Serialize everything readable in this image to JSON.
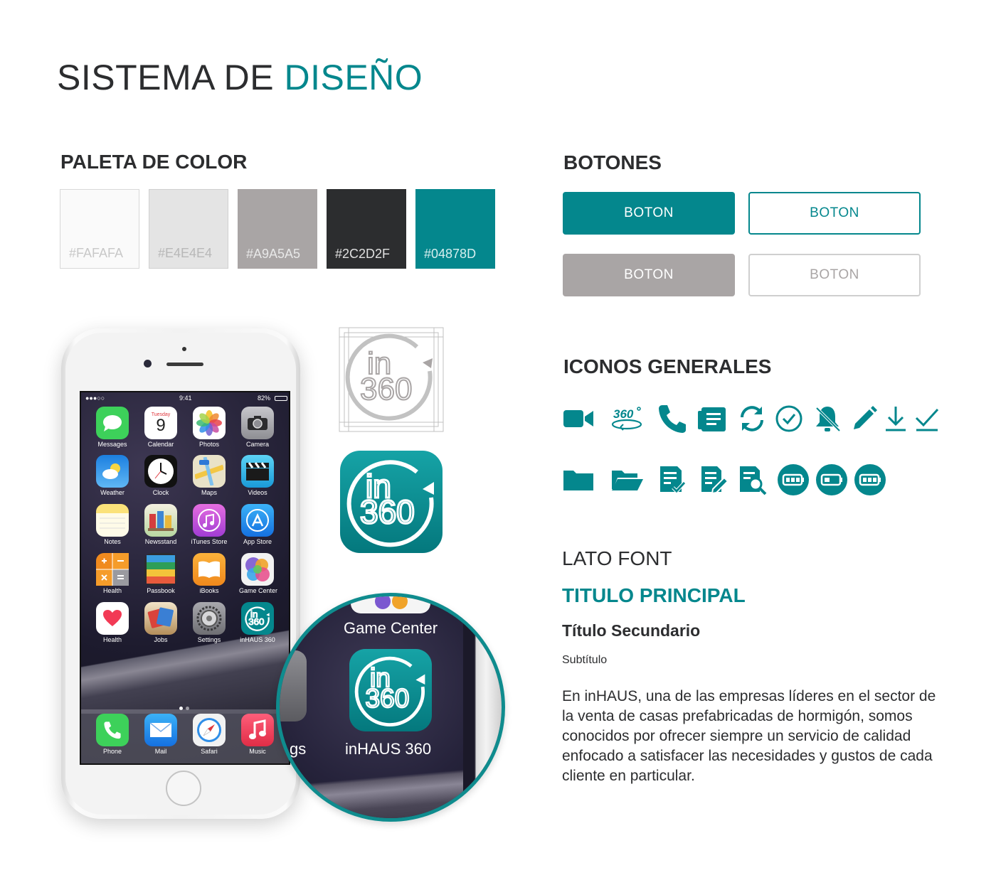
{
  "header": {
    "title_main": "SISTEMA DE",
    "title_accent": "DISEÑO"
  },
  "palette": {
    "heading": "PALETA DE COLOR",
    "swatches": [
      {
        "hex": "#FAFAFA",
        "label": "#FAFAFA"
      },
      {
        "hex": "#E4E4E4",
        "label": "#E4E4E4"
      },
      {
        "hex": "#A9A5A5",
        "label": "#A9A5A5"
      },
      {
        "hex": "#2C2D2F",
        "label": "#2C2D2F"
      },
      {
        "hex": "#04878D",
        "label": "#04878D"
      }
    ]
  },
  "buttons": {
    "heading": "BOTONES",
    "items": [
      {
        "label": "BOTON",
        "style": "primary-filled"
      },
      {
        "label": "BOTON",
        "style": "primary-outline"
      },
      {
        "label": "BOTON",
        "style": "gray-filled"
      },
      {
        "label": "BOTON",
        "style": "gray-outline"
      }
    ]
  },
  "icons": {
    "heading": "ICONOS GENERALES",
    "color": "#04878D",
    "row1": [
      "video-camera-icon",
      "360-view-icon",
      "phone-icon",
      "document-list-icon",
      "sync-icon",
      "check-circle-icon",
      "bell-off-icon",
      "pencil-icon",
      "download-icon",
      "checkmark-icon"
    ],
    "row2": [
      "folder-icon",
      "folder-open-icon",
      "document-check-icon",
      "document-edit-icon",
      "document-search-icon",
      "battery-low-icon",
      "battery-half-icon",
      "battery-full-icon"
    ],
    "row1_text": {
      "360": "360"
    }
  },
  "logo": {
    "text_top": "in",
    "text_bottom": "360",
    "color": "#04878D"
  },
  "typography": {
    "heading": "LATO FONT",
    "title": "TITULO PRINCIPAL",
    "secondary": "Título Secundario",
    "subtitle": "Subtítulo",
    "body": "En inHAUS, una de las empresas líderes en el sector de la venta de casas prefabricadas de hormigón, somos conocidos por ofrecer siempre un servicio de calidad enfocado a satisfacer las necesidades y gustos de cada cliente en particular."
  },
  "phone": {
    "status": {
      "carrier": "●●●○○",
      "time": "9:41",
      "battery": "82%"
    },
    "calendar": {
      "day_name": "Tuesday",
      "day_number": "9"
    },
    "apps": [
      {
        "label": "Messages",
        "icon": "messages-icon",
        "color": "#3dd15a"
      },
      {
        "label": "Calendar",
        "icon": "calendar-icon",
        "color": "#ffffff"
      },
      {
        "label": "Photos",
        "icon": "photos-icon",
        "color": "#ffffff"
      },
      {
        "label": "Camera",
        "icon": "camera-icon",
        "color": "#9a9aa0"
      },
      {
        "label": "Weather",
        "icon": "weather-icon",
        "color": "#2d8ee8"
      },
      {
        "label": "Clock",
        "icon": "clock-icon",
        "color": "#111111"
      },
      {
        "label": "Maps",
        "icon": "maps-icon",
        "color": "#e9e2c8"
      },
      {
        "label": "Videos",
        "icon": "videos-icon",
        "color": "#2fb4e6"
      },
      {
        "label": "Notes",
        "icon": "notes-icon",
        "color": "#fbe27a"
      },
      {
        "label": "Newsstand",
        "icon": "newsstand-icon",
        "color": "#b8d7a2"
      },
      {
        "label": "iTunes Store",
        "icon": "itunes-icon",
        "color": "#d74cd0"
      },
      {
        "label": "App Store",
        "icon": "app-store-icon",
        "color": "#1c8ef0"
      },
      {
        "label": "Health",
        "icon": "calculator-icon",
        "color": "#f08a1e"
      },
      {
        "label": "Passbook",
        "icon": "passbook-icon",
        "color": "#2e9e57"
      },
      {
        "label": "iBooks",
        "icon": "ibooks-icon",
        "color": "#f59a1b"
      },
      {
        "label": "Game Center",
        "icon": "game-center-icon",
        "color": "#f2f2f2"
      },
      {
        "label": "Health",
        "icon": "health-icon",
        "color": "#ffffff"
      },
      {
        "label": "Jobs",
        "icon": "jobs-icon",
        "color": "#c54a2b"
      },
      {
        "label": "Settings",
        "icon": "settings-icon",
        "color": "#8e8e93"
      },
      {
        "label": "inHAUS 360",
        "icon": "inhaus-360-icon",
        "color": "#04878d"
      }
    ],
    "dock": [
      {
        "label": "Phone",
        "icon": "phone-app-icon",
        "color": "#3dd15a"
      },
      {
        "label": "Mail",
        "icon": "mail-icon",
        "color": "#2d8ee8"
      },
      {
        "label": "Safari",
        "icon": "safari-icon",
        "color": "#f2f2f2"
      },
      {
        "label": "Music",
        "icon": "music-icon",
        "color": "#f23a55"
      }
    ]
  },
  "magnifier": {
    "top_label": "Game Center",
    "bottom_label": "inHAUS 360",
    "fragment": "gs"
  }
}
